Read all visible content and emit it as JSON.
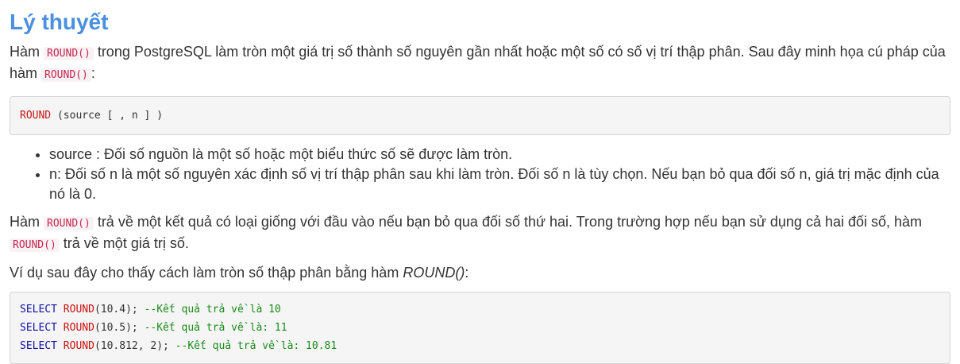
{
  "title": "Lý thuyết",
  "para1": {
    "t1": "Hàm ",
    "c1": "ROUND()",
    "t2": " trong PostgreSQL làm tròn một giá trị số thành số nguyên gần nhất hoặc một số có số vị trí thập phân. Sau đây minh họa cú pháp của hàm ",
    "c2": "ROUND()",
    "t3": ":"
  },
  "syntax": {
    "keyword": "ROUND",
    "rest": " (source [ , n ] )"
  },
  "list": [
    "source : Đối số nguồn là một số hoặc một biểu thức số sẽ được làm tròn.",
    "n: Đối số n là một số nguyên xác định số vị trí thập phân sau khi làm tròn. Đối số n là tùy chọn. Nếu bạn bỏ qua đối số n, giá trị mặc định của nó là 0."
  ],
  "para2": {
    "t1": "Hàm ",
    "c1": "ROUND()",
    "t2": " trả về một kết quả có loại giống với đầu vào nếu bạn bỏ qua đối số thứ hai. Trong trường hợp nếu bạn sử dụng cả hai đối số, hàm ",
    "c2": "ROUND()",
    "t3": " trả về một giá trị số."
  },
  "para3": {
    "t1": "Ví dụ sau đây cho thấy cách làm tròn số thập phân bằng hàm ",
    "em": "ROUND()",
    "t2": ":"
  },
  "example": [
    {
      "select": "SELECT",
      "fn": "ROUND",
      "args": "(10.4); ",
      "comment": "--Kết quả trả về là 10"
    },
    {
      "select": "SELECT",
      "fn": "ROUND",
      "args": "(10.5); ",
      "comment": "--Kết quả trả về là: 11"
    },
    {
      "select": "SELECT",
      "fn": "ROUND",
      "args": "(10.812, 2); ",
      "comment": "--Kết quả trả về là: 10.81"
    }
  ],
  "colors": {
    "title": "#4a8fe0",
    "inline_code": "#c7254e",
    "keyword_red": "#cc1111",
    "keyword_blue": "#1010a8",
    "comment": "#1a8a1a"
  }
}
